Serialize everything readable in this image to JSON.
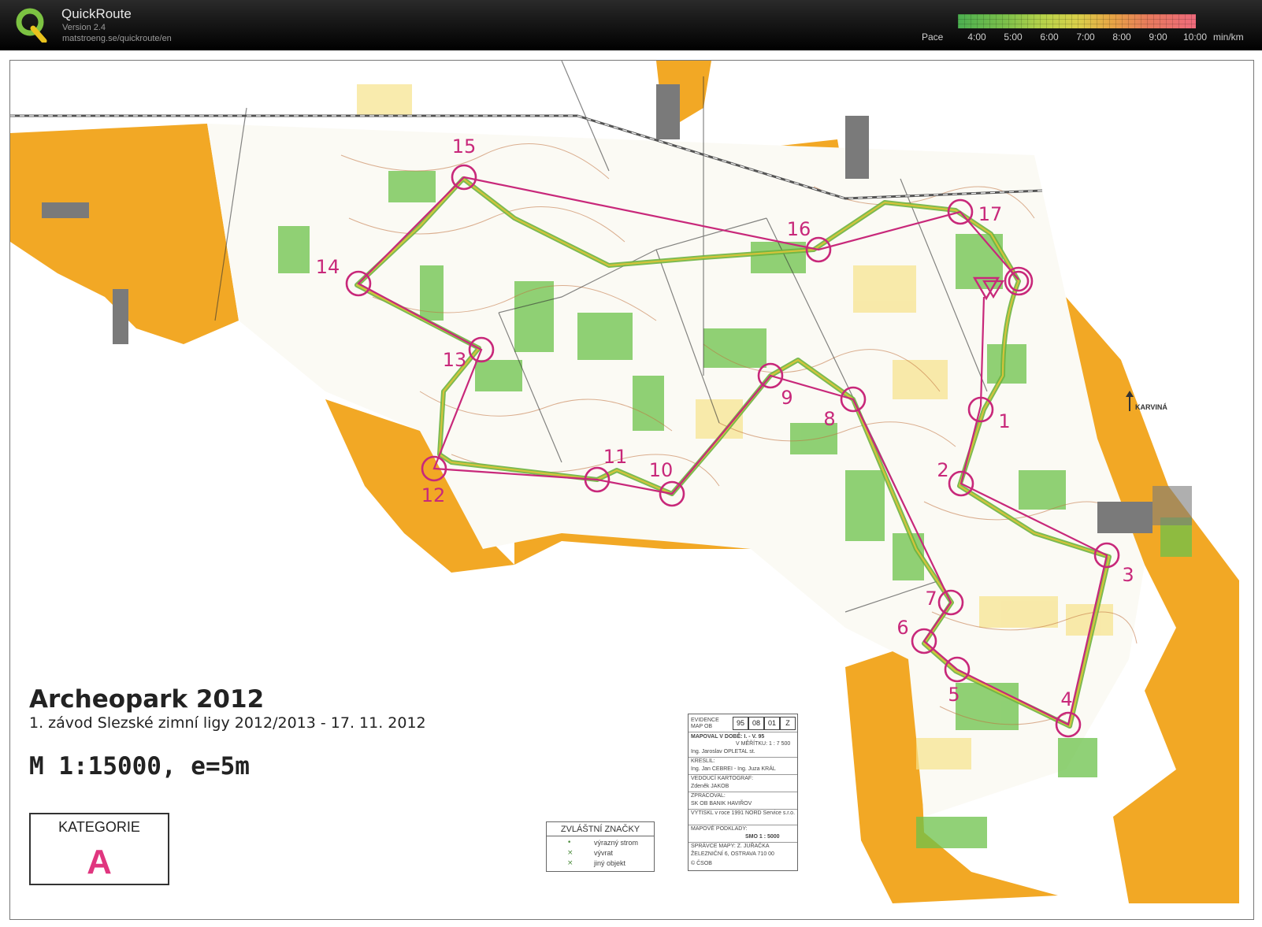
{
  "app": {
    "title": "QuickRoute",
    "version": "Version 2.4",
    "url": "matstroeng.se/quickroute/en"
  },
  "pace_scale": {
    "label": "Pace",
    "ticks": [
      "4:00",
      "5:00",
      "6:00",
      "7:00",
      "8:00",
      "9:00",
      "10:00"
    ],
    "unit": "min/km",
    "colors": [
      "#4caf50",
      "#b5d24a",
      "#d9d04a",
      "#e7a445",
      "#ee6a7c"
    ]
  },
  "map": {
    "title": "Archeopark 2012",
    "subtitle": "1. závod Slezské zimní ligy 2012/2013 - 17. 11. 2012",
    "scale": "M 1:15000, e=5m",
    "category_label": "KATEGORIE",
    "category_value": "A",
    "north_label": "KARVINÁ",
    "controls": [
      "1",
      "2",
      "3",
      "4",
      "5",
      "6",
      "7",
      "8",
      "9",
      "10",
      "11",
      "12",
      "13",
      "14",
      "15",
      "16",
      "17"
    ],
    "legend": {
      "title": "ZVLÁŠTNÍ ZNAČKY",
      "items": [
        "výrazný strom",
        "vývrat",
        "jiný objekt"
      ]
    },
    "info_box": {
      "evidence_label": "EVIDENCE MAP OB",
      "codes": [
        "95",
        "08",
        "01",
        "Z"
      ],
      "rows": [
        "MAPOVAL V DOBĚ: I. - V. 95",
        "V MĚŘÍTKU: 1 : 7 500",
        "Ing. Jaroslav OPLETAL st.",
        "KRESLIL:",
        "Ing. Jan CEBREI - Ing. Juza KRÁL",
        "VEDOUCÍ KARTOGRAF:",
        "Zdeněk JAKOB",
        "ZPRACOVAL:",
        "SK OB BANIK HAVIŘOV",
        "VYTISKL v roce 1991 NORD Service s.r.o.",
        "MAPOVÉ PODKLADY:",
        "SMO 1 : 5000",
        "SPRÁVCE MAPY: Z. JUŘAČKA",
        "ŽELEZNIČNÍ 6, OSTRAVA 710 00",
        "© ČSOB"
      ]
    },
    "colors": {
      "course": "#c8287a",
      "route_green": "#6db33f",
      "route_yellow": "#d8c43a",
      "open_land": "#f2a825",
      "forest_green": "#6cc24a",
      "contour": "#c0703c"
    }
  }
}
